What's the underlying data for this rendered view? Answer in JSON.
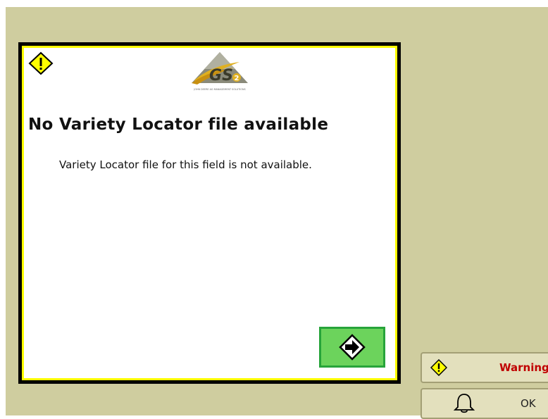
{
  "dialog": {
    "title": "No Variety Locator file available",
    "message": "Variety Locator file for this field is not available.",
    "icon": "warning-icon",
    "logo_text": "GS2",
    "logo_subtext": "JOHN DEERE AG MANAGEMENT SOLUTIONS",
    "next_button_icon": "arrow-right-icon"
  },
  "alerts": {
    "warning_label": "Warning",
    "ok_label": "OK"
  },
  "colors": {
    "background": "#cfcd9f",
    "dialog_border": "#fefe00",
    "button_green": "#6cd35c",
    "warning_text": "#c00000"
  }
}
